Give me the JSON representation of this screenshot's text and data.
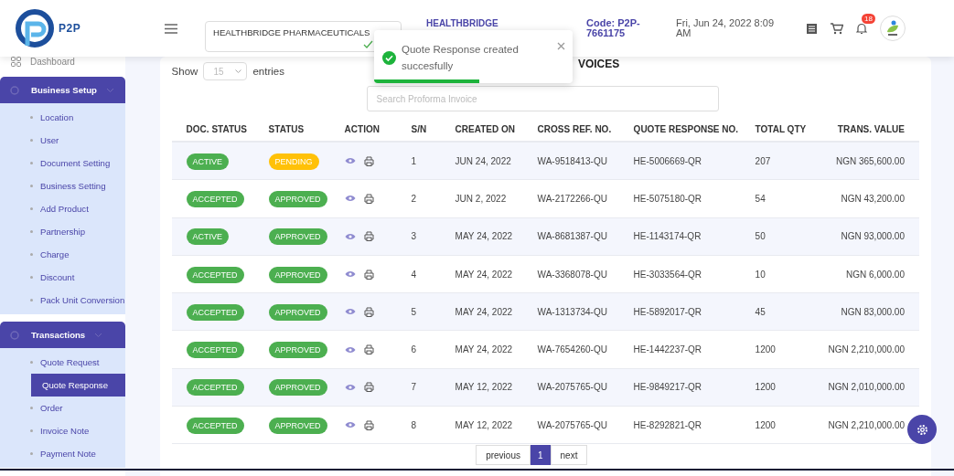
{
  "header": {
    "logo_text": "P2P",
    "company_select": {
      "value": "HEALTHBRIDGE PHARMACEUTICALS",
      "valid": true
    },
    "company_name": "HEALTHBRIDGE",
    "code": "Code: P2P-7661175",
    "datetime": "Fri, Jun 24, 2022 8:09 AM",
    "notification_count": "18"
  },
  "toast": {
    "message": "Quote Response created succesfully",
    "level": 0.53
  },
  "sidebar": {
    "items": [
      {
        "kind": "link",
        "label": "Dashboard"
      },
      {
        "kind": "group",
        "label": "Business Setup",
        "expanded": true,
        "children": [
          {
            "label": "Location",
            "selected": false
          },
          {
            "label": "User",
            "selected": false
          },
          {
            "label": "Document Setting",
            "selected": false
          },
          {
            "label": "Business Setting",
            "selected": false
          },
          {
            "label": "Add Product",
            "selected": false
          },
          {
            "label": "Partnership",
            "selected": false
          },
          {
            "label": "Charge",
            "selected": false
          },
          {
            "label": "Discount",
            "selected": false
          },
          {
            "label": "Pack Unit Conversion",
            "selected": false
          }
        ]
      },
      {
        "kind": "group",
        "label": "Transactions",
        "expanded": true,
        "children": [
          {
            "label": "Quote Request",
            "selected": false
          },
          {
            "label": "Quote Response",
            "selected": true
          },
          {
            "label": "Order",
            "selected": false
          },
          {
            "label": "Invoice Note",
            "selected": false
          },
          {
            "label": "Payment Note",
            "selected": false
          }
        ]
      }
    ]
  },
  "card": {
    "title": "VOICES",
    "show_label": "Show",
    "page_size": "15",
    "entries_label": "entries",
    "search": {
      "placeholder": "Search Proforma Invoice"
    },
    "table": {
      "columns": [
        "DOC. STATUS",
        "STATUS",
        "ACTION",
        "S/N",
        "CREATED ON",
        "CROSS REF. NO.",
        "QUOTE RESPONSE NO.",
        "TOTAL QTY",
        "TRANS. VALUE"
      ],
      "rows": [
        {
          "doc_status": {
            "text": "ACTIVE",
            "color": "#4caf50"
          },
          "status": {
            "text": "PENDING",
            "color": "#ffc107"
          },
          "sn": "1",
          "created_on": "JUN 24, 2022",
          "cross_ref": "WA-9518413-QU",
          "quote_response": "HE-5006669-QR",
          "total_qty": "207",
          "trans_value": "NGN 365,600.00"
        },
        {
          "doc_status": {
            "text": "ACCEPTED",
            "color": "#4caf50"
          },
          "status": {
            "text": "APPROVED",
            "color": "#4caf50"
          },
          "sn": "2",
          "created_on": "JUN 2, 2022",
          "cross_ref": "WA-2172266-QU",
          "quote_response": "HE-5075180-QR",
          "total_qty": "54",
          "trans_value": "NGN 43,200.00"
        },
        {
          "doc_status": {
            "text": "ACTIVE",
            "color": "#4caf50"
          },
          "status": {
            "text": "APPROVED",
            "color": "#4caf50"
          },
          "sn": "3",
          "created_on": "MAY 24, 2022",
          "cross_ref": "WA-8681387-QU",
          "quote_response": "HE-1143174-QR",
          "total_qty": "50",
          "trans_value": "NGN 93,000.00"
        },
        {
          "doc_status": {
            "text": "ACCEPTED",
            "color": "#4caf50"
          },
          "status": {
            "text": "APPROVED",
            "color": "#4caf50"
          },
          "sn": "4",
          "created_on": "MAY 24, 2022",
          "cross_ref": "WA-3368078-QU",
          "quote_response": "HE-3033564-QR",
          "total_qty": "10",
          "trans_value": "NGN 6,000.00"
        },
        {
          "doc_status": {
            "text": "ACCEPTED",
            "color": "#4caf50"
          },
          "status": {
            "text": "APPROVED",
            "color": "#4caf50"
          },
          "sn": "5",
          "created_on": "MAY 24, 2022",
          "cross_ref": "WA-1313734-QU",
          "quote_response": "HE-5892017-QR",
          "total_qty": "45",
          "trans_value": "NGN 83,000.00"
        },
        {
          "doc_status": {
            "text": "ACCEPTED",
            "color": "#4caf50"
          },
          "status": {
            "text": "APPROVED",
            "color": "#4caf50"
          },
          "sn": "6",
          "created_on": "MAY 24, 2022",
          "cross_ref": "WA-7654260-QU",
          "quote_response": "HE-1442237-QR",
          "total_qty": "1200",
          "trans_value": "NGN 2,210,000.00"
        },
        {
          "doc_status": {
            "text": "ACCEPTED",
            "color": "#4caf50"
          },
          "status": {
            "text": "APPROVED",
            "color": "#4caf50"
          },
          "sn": "7",
          "created_on": "MAY 12, 2022",
          "cross_ref": "WA-2075765-QU",
          "quote_response": "HE-9849217-QR",
          "total_qty": "1200",
          "trans_value": "NGN 2,010,000.00"
        },
        {
          "doc_status": {
            "text": "ACCEPTED",
            "color": "#4caf50"
          },
          "status": {
            "text": "APPROVED",
            "color": "#4caf50"
          },
          "sn": "8",
          "created_on": "MAY 12, 2022",
          "cross_ref": "WA-2075765-QU",
          "quote_response": "HE-8292821-QR",
          "total_qty": "1200",
          "trans_value": "NGN 2,210,000.00"
        }
      ]
    },
    "pagination": {
      "previous": "previous",
      "pages": [
        {
          "label": "1",
          "selected": true
        }
      ],
      "next": "next"
    }
  }
}
